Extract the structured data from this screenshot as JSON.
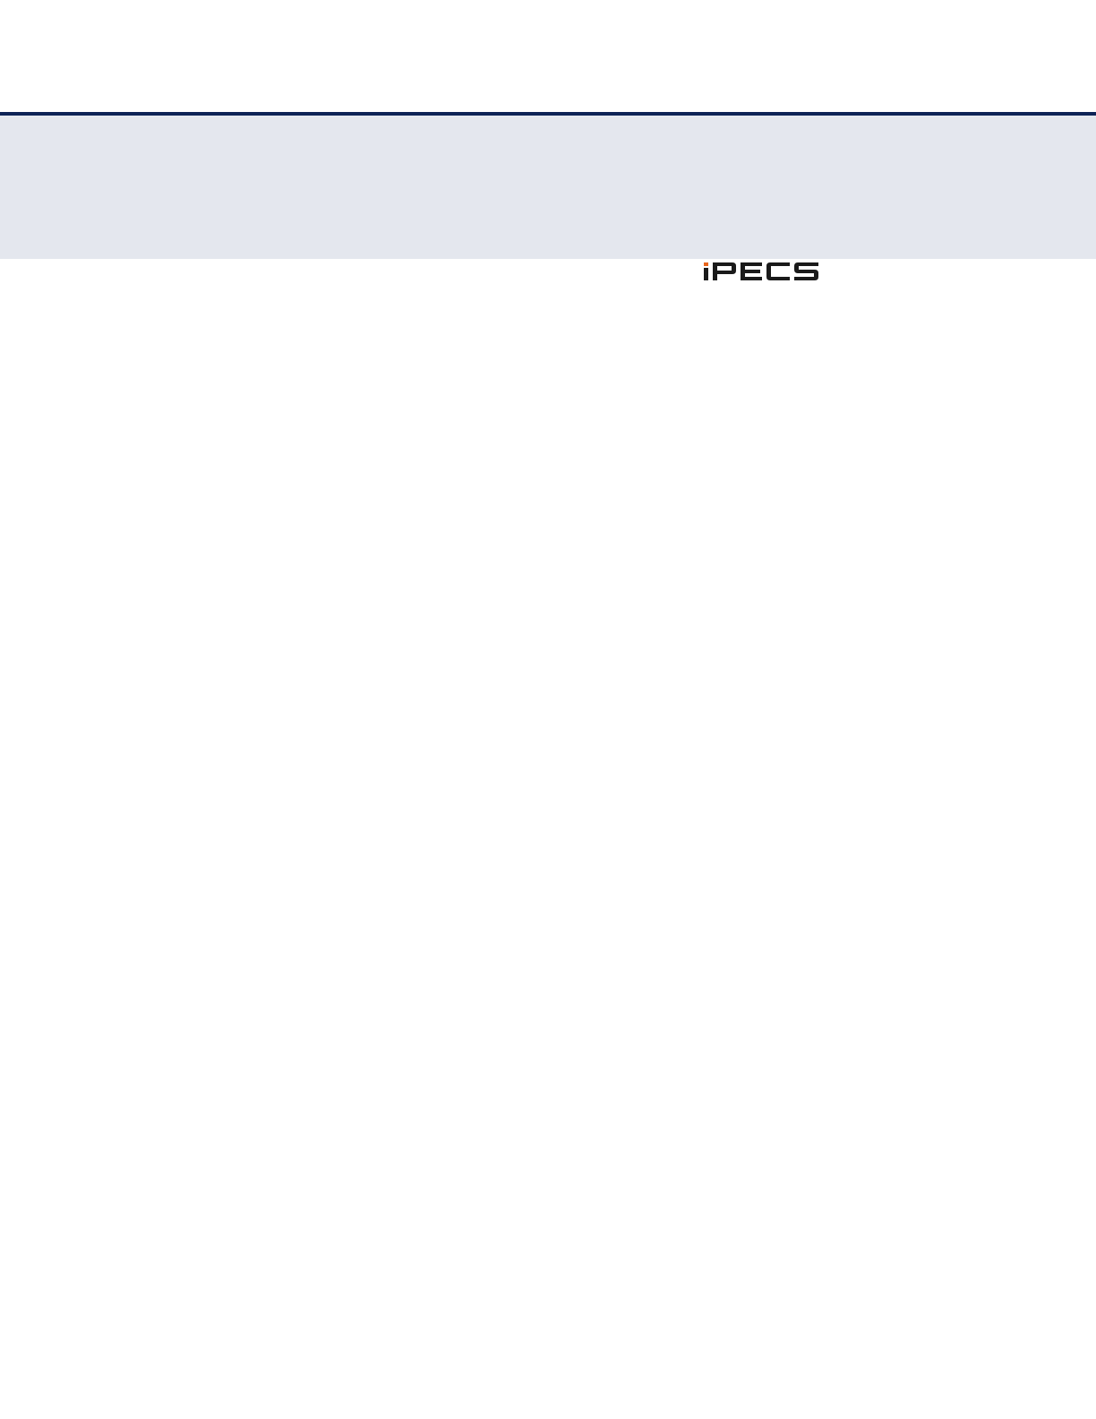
{
  "page": {
    "colors": {
      "rule": "#0e2356",
      "band": "#e4e7ee",
      "background": "#ffffff",
      "logo_dot": "#e8651c",
      "logo_text": "#1a1a1a"
    }
  },
  "logo": {
    "text": "iPECS",
    "icon": "ipecs-logo"
  }
}
